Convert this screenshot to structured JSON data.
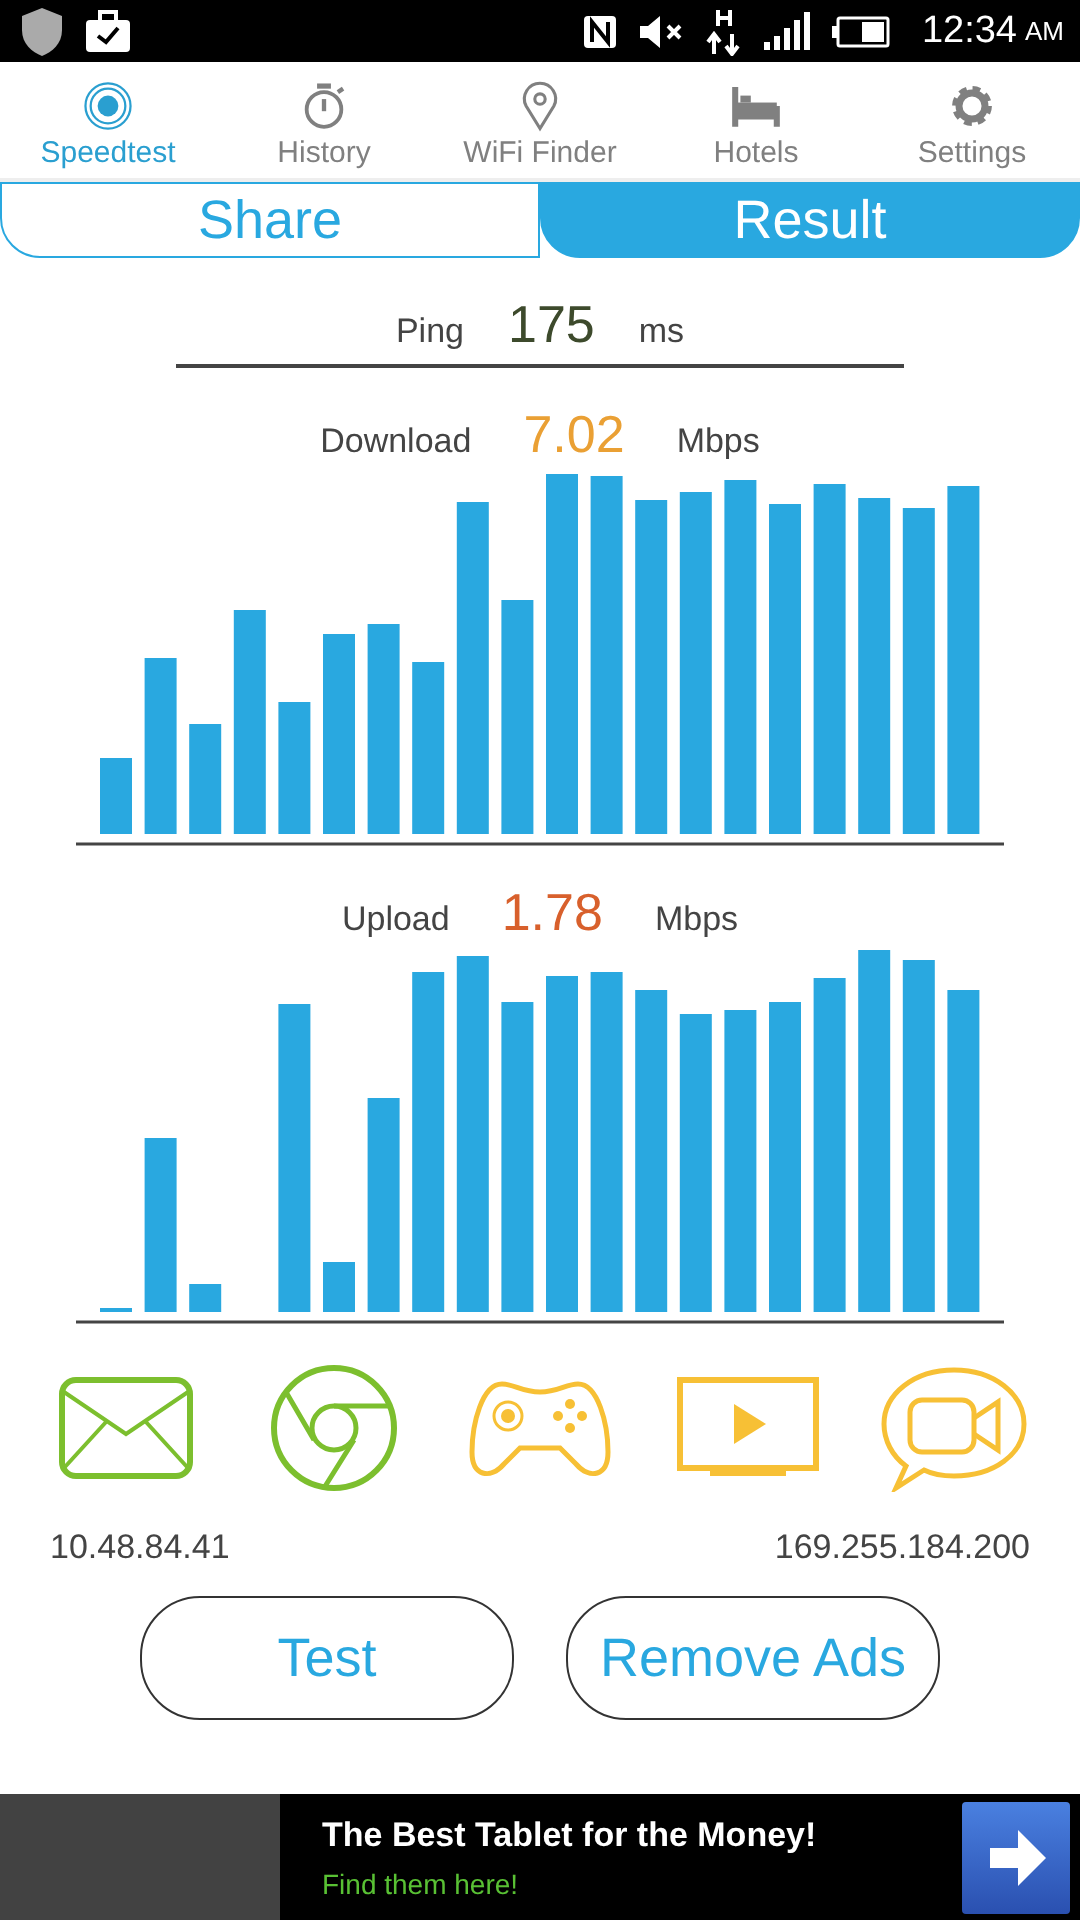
{
  "status_bar": {
    "time": "12:34",
    "meridiem": "AM"
  },
  "tabs": [
    {
      "label": "Speedtest",
      "selected": true,
      "kind": "rings"
    },
    {
      "label": "History",
      "selected": false,
      "kind": "stopwatch"
    },
    {
      "label": "WiFi Finder",
      "selected": false,
      "kind": "pin"
    },
    {
      "label": "Hotels",
      "selected": false,
      "kind": "bed"
    },
    {
      "label": "Settings",
      "selected": false,
      "kind": "gear"
    }
  ],
  "segments": [
    {
      "label": "Share",
      "selected": false
    },
    {
      "label": "Result",
      "selected": true
    }
  ],
  "ping": {
    "label": "Ping",
    "value": "175",
    "unit": "ms",
    "color": "#3d4a2c"
  },
  "download": {
    "label": "Download",
    "value": "7.02",
    "unit": "Mbps",
    "color": "#eaa034"
  },
  "upload": {
    "label": "Upload",
    "value": "1.78",
    "unit": "Mbps",
    "color": "#d8602c"
  },
  "services": [
    {
      "kind": "mail",
      "color": "#7cbf2e"
    },
    {
      "kind": "browser",
      "color": "#7cbf2e"
    },
    {
      "kind": "game",
      "color": "#f7c035"
    },
    {
      "kind": "video",
      "color": "#f7c035"
    },
    {
      "kind": "call",
      "color": "#f7c035"
    }
  ],
  "local_ip": "10.48.84.41",
  "server_ip": "169.255.184.200",
  "buttons": [
    "Test",
    "Remove Ads"
  ],
  "ad": {
    "headline": "The Best Tablet for the Money!",
    "subline": "Find them here!"
  }
}
